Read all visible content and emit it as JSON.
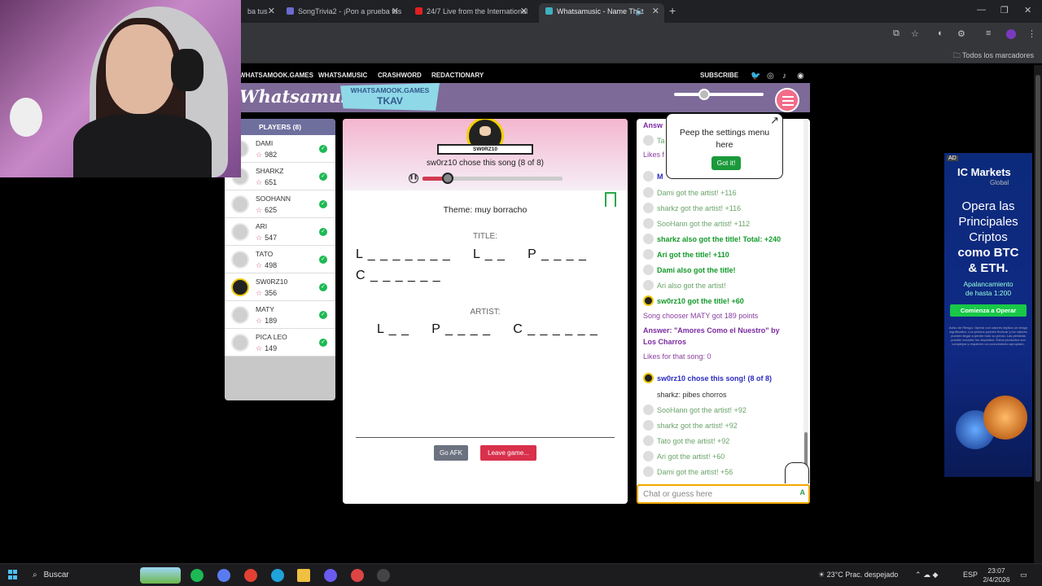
{
  "browser": {
    "tabs": [
      {
        "label": "ba tus"
      },
      {
        "label": "SongTrivia2 - ¡Pon a prueba tus"
      },
      {
        "label": "24/7 Live from the International"
      },
      {
        "label": "Whatsamusic - Name That"
      }
    ],
    "bookmarks_folder": "Todos los marcadores"
  },
  "site": {
    "nav": [
      "WHATSAMOOK.GAMES",
      "WHATSAMUSIC",
      "CRASHWORD",
      "REDACTIONARY"
    ],
    "subscribe": "SUBSCRIBE",
    "logo": "Whatsamusic",
    "room_site": "WHATSAMOOK.GAMES",
    "room_code": "TKAV"
  },
  "players": {
    "header": "PLAYERS (8)",
    "list": [
      {
        "name": "DAMI",
        "points": "982"
      },
      {
        "name": "SHARKZ",
        "points": "651"
      },
      {
        "name": "SOOHANN",
        "points": "625"
      },
      {
        "name": "ARI",
        "points": "547"
      },
      {
        "name": "TATO",
        "points": "498"
      },
      {
        "name": "SW0RZ10",
        "points": "356"
      },
      {
        "name": "MATY",
        "points": "189"
      },
      {
        "name": "PICA LEO",
        "points": "149"
      }
    ]
  },
  "game": {
    "chooser_ribbon": "SW0RZ10",
    "chose_text": "sw0rz10 chose this song (8 of 8)",
    "playback_progress": 0.18,
    "theme": "Theme: muy borracho",
    "title_label": "TITLE:",
    "title_hint_line1": "L _ _ _ _ _ _ _     L _ _     P _ _ _ _",
    "title_hint_line2": "C _ _ _ _ _ _",
    "artist_label": "ARTIST:",
    "artist_hint": "L _ _     P _ _ _ _     C _ _ _ _ _ _",
    "afk_button": "Go AFK",
    "leave_button": "Leave game..."
  },
  "chat": {
    "top": [
      {
        "text": "Answ"
      },
      {
        "text": "Ta"
      },
      {
        "text": "Likes f"
      },
      {
        "text": "M"
      }
    ],
    "messages": [
      {
        "text": "Dami got the artist! +116"
      },
      {
        "text": "sharkz got the artist! +116"
      },
      {
        "text": "SooHann got the artist! +112"
      },
      {
        "text": "sharkz also got the title! Total: +240"
      },
      {
        "text": "Ari got the title! +110"
      },
      {
        "text": "Dami also got the title!"
      },
      {
        "text": "Ari also got the artist!"
      },
      {
        "text": "sw0rz10 got the title! +60"
      },
      {
        "text": "Song chooser MATY got 189 points"
      },
      {
        "text": "Answer: \"Amores Como el Nuestro\" by"
      },
      {
        "text": "Los Charros"
      },
      {
        "text": "Likes for that song: 0"
      },
      {
        "text": "sw0rz10 chose this song! (8 of 8)"
      },
      {
        "text": "sharkz: pibes chorros"
      },
      {
        "text": "SooHann got the artist! +92"
      },
      {
        "text": "sharkz got the artist! +92"
      },
      {
        "text": "Tato got the artist! +92"
      },
      {
        "text": "Ari got the artist! +60"
      },
      {
        "text": "Dami got the artist! +56"
      }
    ],
    "placeholder": "Chat or guess here",
    "send": "A"
  },
  "tooltip": {
    "line1": "Peep the settings menu",
    "line2": "here",
    "button": "Got it!"
  },
  "ad": {
    "tag": "AD",
    "brand": "IC Markets",
    "sub": "Global",
    "headline1": "Opera las",
    "headline2": "Principales",
    "headline3": "Criptos",
    "headline4": "como BTC",
    "headline5": "& ETH.",
    "small1": "Apalancamiento",
    "small2": "de hasta 1:200",
    "cta": "Comienza a Operar",
    "legal": "Aviso de Riesgo: Operar con valores implica un riesgo significativo. Los precios pueden fluctuar y los valores pueden llegar a perder todo su precio. Las pérdidas pueden exceder los depósitos. Estos productos son complejos y requieren un conocimiento apropiado."
  },
  "taskbar": {
    "search": "Buscar",
    "weather": "23°C  Prac. despejado",
    "lang": "ESP",
    "time": "23:07",
    "date": "2/4/2026"
  }
}
